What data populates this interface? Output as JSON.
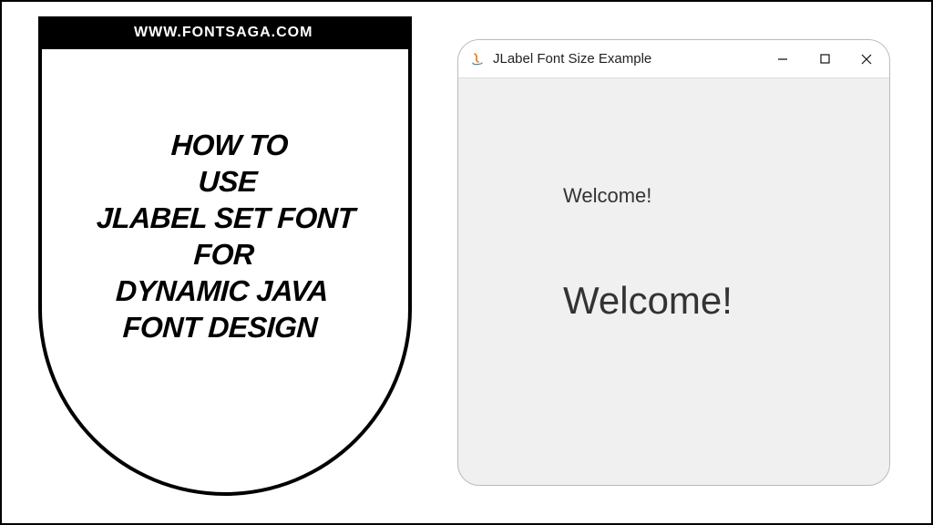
{
  "url_bar": "WWW.FONTSAGA.COM",
  "heading_html": "HOW TO<br>USE<br>JLABEL SET FONT<br>FOR<br>DYNAMIC JAVA<br>FONT DESIGN",
  "window": {
    "title": "JLabel Font Size Example",
    "label_small": "Welcome!",
    "label_large": "Welcome!"
  }
}
